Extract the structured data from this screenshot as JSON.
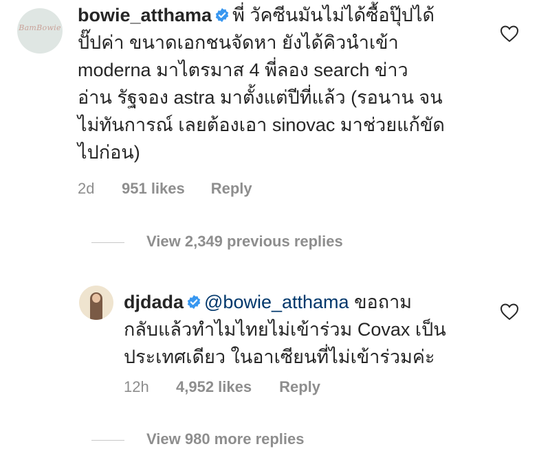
{
  "comments": [
    {
      "username": "bowie_atthama",
      "avatar_logo_text": "BamBowie",
      "lines": [
        "พี่ วัคซีนมันไม่ได้ซื้อปุ๊ปได้",
        "ปั๊ปค่า ขนาดเอกชนจัดหา ยังได้คิวนำเข้า",
        "moderna มาไตรมาส 4 พี่ลอง search ข่าว",
        "อ่าน รัฐจอง astra มาตั้งแต่ปีที่แล้ว (รอนาน จน",
        "ไม่ทันการณ์ เลยต้องเอา sinovac มาช่วยแก้ขัด",
        "ไปก่อน)"
      ],
      "time": "2d",
      "likes": "951 likes",
      "reply": "Reply"
    },
    {
      "username": "djdada",
      "mention": "@bowie_atthama",
      "lines": [
        "ขอถาม",
        "กลับแล้วทำไมไทยไม่เข้าร่วม Covax เป็น",
        "ประเทศเดียว ในอาเซียนที่ไม่เข้าร่วมค่ะ"
      ],
      "time": "12h",
      "likes": "4,952 likes",
      "reply": "Reply"
    }
  ],
  "view_previous": "View 2,349 previous replies",
  "view_more": "View 980 more replies",
  "colors": {
    "text": "#262626",
    "secondary": "#8e8e8e",
    "verified": "#3897f0",
    "mention": "#00376b"
  },
  "icons": [
    "verified-badge-icon",
    "heart-icon"
  ]
}
